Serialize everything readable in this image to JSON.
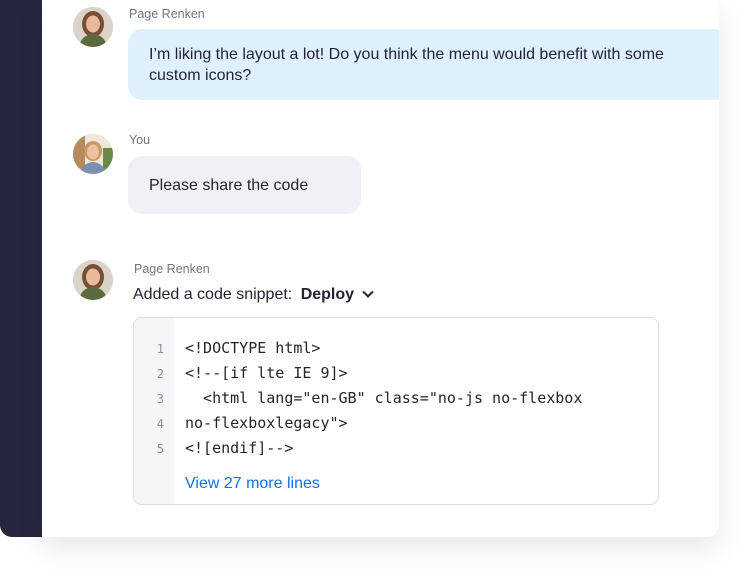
{
  "messages": [
    {
      "sender": "Page Renken",
      "text": "I’m liking the layout a lot! Do you think the menu would benefit with some custom icons?"
    },
    {
      "sender": "You",
      "text": "Please share the code"
    },
    {
      "sender": "Page Renken",
      "snippet_prefix": "Added a code snippet:",
      "snippet_name": "Deploy",
      "code_lines": [
        {
          "num": "1",
          "text": "<!DOCTYPE html>"
        },
        {
          "num": "2",
          "text": "<!--[if lte IE 9]>"
        },
        {
          "num": "3",
          "text": "  <html lang=\"en-GB\" class=\"no-js no-flexbox"
        },
        {
          "num": "4",
          "text": "no-flexboxlegacy\">"
        },
        {
          "num": "5",
          "text": "<![endif]-->"
        }
      ],
      "more_lines_link": "View 27 more lines"
    }
  ],
  "colors": {
    "sidebar": "#26263f",
    "incoming_bubble": "#dff0fd",
    "outgoing_bubble": "#f1f1f5",
    "link": "#0e72ed"
  }
}
